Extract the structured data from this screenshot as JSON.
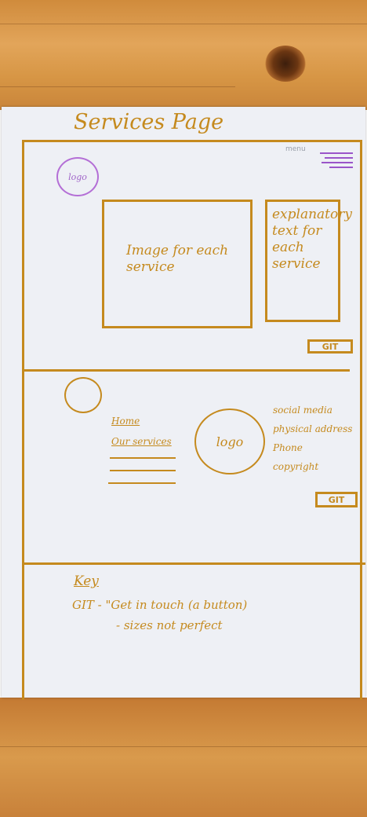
{
  "sketch": {
    "title": "Services Page",
    "header": {
      "menu_label": "menu",
      "logo_label": "logo"
    },
    "service": {
      "image_placeholder": "Image for each service",
      "explanatory_text": "explanatory text for each service",
      "button_label": "GIT"
    },
    "footer": {
      "nav": [
        "Home",
        "Our services"
      ],
      "logo_label": "logo",
      "info": [
        "social media",
        "physical address",
        "Phone",
        "copyright"
      ],
      "button_label": "GIT"
    },
    "key": {
      "heading": "Key",
      "entries": [
        "GIT - \"Get in touch (a button)",
        "- sizes not perfect"
      ]
    }
  }
}
